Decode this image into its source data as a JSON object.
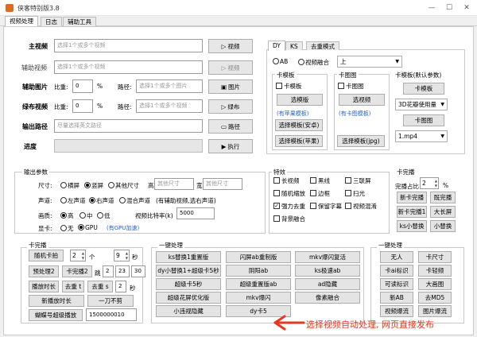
{
  "app": {
    "title": "侠客特别版3.8"
  },
  "tabs": [
    "视频处理",
    "日志",
    "辅助工具"
  ],
  "inputs": {
    "main_video": {
      "label": "主视频",
      "placeholder": "选择1个或多个视频",
      "button": "视频"
    },
    "aux_video": {
      "label": "辅助视频",
      "placeholder": "选择1个或多个视频",
      "button": "视频"
    },
    "aux_image": {
      "label": "辅助图片",
      "ratio_label": "比重:",
      "ratio": "0",
      "unit": "%",
      "path_label": "路径:",
      "placeholder": "选择1个或多个图片",
      "button": "图片"
    },
    "green_video": {
      "label": "绿布视频",
      "ratio_label": "比重:",
      "ratio": "0",
      "unit": "%",
      "path_label": "路径:",
      "placeholder": "选择1个或多个视频",
      "button": "绿布"
    },
    "output": {
      "label": "输出路径",
      "placeholder": "尽量选择英文路径",
      "button": "路径"
    },
    "progress": {
      "label": "进度",
      "button": "执行"
    }
  },
  "platform_tabs": [
    "DY",
    "KS",
    "去重模式"
  ],
  "mode": {
    "ab": "AB",
    "fusion": "视频融合",
    "select": "上"
  },
  "card_template": {
    "title": "卡模板",
    "checkbox": "卡模板",
    "btn_select": "选模版",
    "link": "(有苹果模板)",
    "btn_android": "选择模板(安卓)",
    "btn_apple": "选择模板(苹果)"
  },
  "card_image": {
    "title": "卡图图",
    "checkbox": "卡图图",
    "btn_select": "选视频",
    "link": "(有卡图模板)",
    "btn_jpg": "选择模板(jpg)"
  },
  "card_default": {
    "title": "卡模板(默认参数)",
    "btn_template": "卡模板",
    "select_3d": "3D花瓣使用量",
    "btn_card_image": "卡图图",
    "select_mp4": "1.mp4"
  },
  "output_params": {
    "title": "输出参数",
    "size_label": "尺寸:",
    "sizes": [
      "横屏",
      "竖屏",
      "其他尺寸"
    ],
    "size_selected": 1,
    "height_label": "高",
    "height_placeholder": "其他尺寸",
    "width_label": "宽",
    "width_placeholder": "其他尺寸",
    "audio_label": "声道:",
    "audio": [
      "左声道",
      "右声道",
      "混合声道"
    ],
    "audio_selected": 1,
    "audio_note": "(有辅助视频,选右声道)",
    "quality_label": "画质:",
    "quality": [
      "高",
      "中",
      "低"
    ],
    "quality_selected": 0,
    "bitrate_label": "视频比特率(k)",
    "bitrate": "5000",
    "gpu_label": "显卡:",
    "gpu": [
      "无",
      "GPU"
    ],
    "gpu_selected": 1,
    "gpu_link": "(有GPU加速)"
  },
  "effects": {
    "title": "特效",
    "items": [
      [
        "长视频",
        "黑线",
        "三联屏"
      ],
      [
        "随机缩放",
        "边框",
        "扫光"
      ],
      [
        "强力去重",
        "保留字幕",
        "视频混淆"
      ],
      [
        "背景融合",
        "",
        ""
      ]
    ],
    "checked": [
      "强力去重"
    ]
  },
  "card_shield": {
    "title": "卡完播",
    "ratio_label": "完播占比",
    "ratio": "2",
    "unit": "%",
    "buttons": [
      [
        "新卡完播",
        "既完播"
      ],
      [
        "新卡完播1",
        "大长屏"
      ],
      [
        "ks小替换",
        "小替换"
      ]
    ]
  },
  "card_play": {
    "title": "卡完播",
    "random_label": "随机卡拍",
    "rand_a": "2",
    "rand_to": "个",
    "rand_b": "9",
    "rand_unit": "秒",
    "preset2_label": "预处理2",
    "card2_label": "卡完播2",
    "jump_label": "跳",
    "card2_a": "2",
    "card2_b": "23",
    "card2_c": "30",
    "pause_label": "播放时长",
    "go_label": "去重 t",
    "go2_label": "去重 s",
    "go2_val": "2",
    "go2_unit": "秒",
    "new_pause_label": "新播放时长",
    "cut_label": "一刀不剪",
    "butterfly_label": "蝴蝶号超级播放",
    "butterfly_val": "1500000010"
  },
  "one_key_1": {
    "title": "一键处理",
    "buttons": [
      [
        "ks替换1重置版",
        "闪屏ab重制版",
        "mkv爆闪复活"
      ],
      [
        "dy小替换1+超级卡5秒",
        "阴阳ab",
        "ks极速ab"
      ],
      [
        "超级卡5秒",
        "超级重置版ab",
        "ad隐藏"
      ],
      [
        "超级花屏优化版",
        "mkv爆闪",
        "像素融合"
      ],
      [
        "小违规隐藏",
        "dy卡5",
        ""
      ]
    ]
  },
  "one_key_2": {
    "title": "一键处理",
    "buttons": [
      [
        "无人",
        "卡尺寸"
      ],
      [
        "卡ai标识",
        "卡轻频"
      ],
      [
        "可读标识",
        "大画图"
      ],
      [
        "新AB",
        "去MD5"
      ],
      [
        "视频爆流",
        "图片爆流"
      ]
    ]
  },
  "annotation": "选择视频自动处理, 网页直接发布",
  "colors": {
    "accent": "#e8361f",
    "link": "#2563c9",
    "brand": "#e06a1e"
  }
}
